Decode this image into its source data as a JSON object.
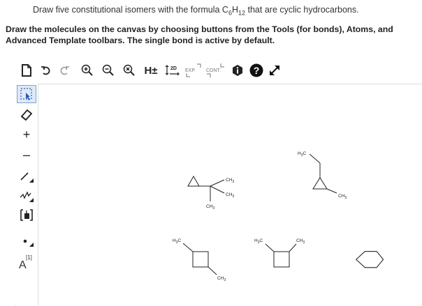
{
  "question": {
    "prefix": "Draw five constitutional isomers with the formula C",
    "sub1": "6",
    "mid": "H",
    "sub2": "12",
    "suffix": " that are cyclic hydrocarbons."
  },
  "instructions": "Draw the molecules on the canvas by choosing buttons from the Tools (for bonds), Atoms, and Advanced Template toolbars. The single bond is active by default.",
  "top_toolbar": {
    "h_toggle": "H±",
    "twod": "2D",
    "exp": "EXP.",
    "cont": "CONT."
  },
  "left_toolbar": {
    "plus": "+",
    "minus": "–",
    "atom_label": "A",
    "atom_index": "[1]"
  },
  "molecules": {
    "labels": {
      "ch3": "CH",
      "h3c": "H",
      "three": "3",
      "c": "C"
    }
  }
}
